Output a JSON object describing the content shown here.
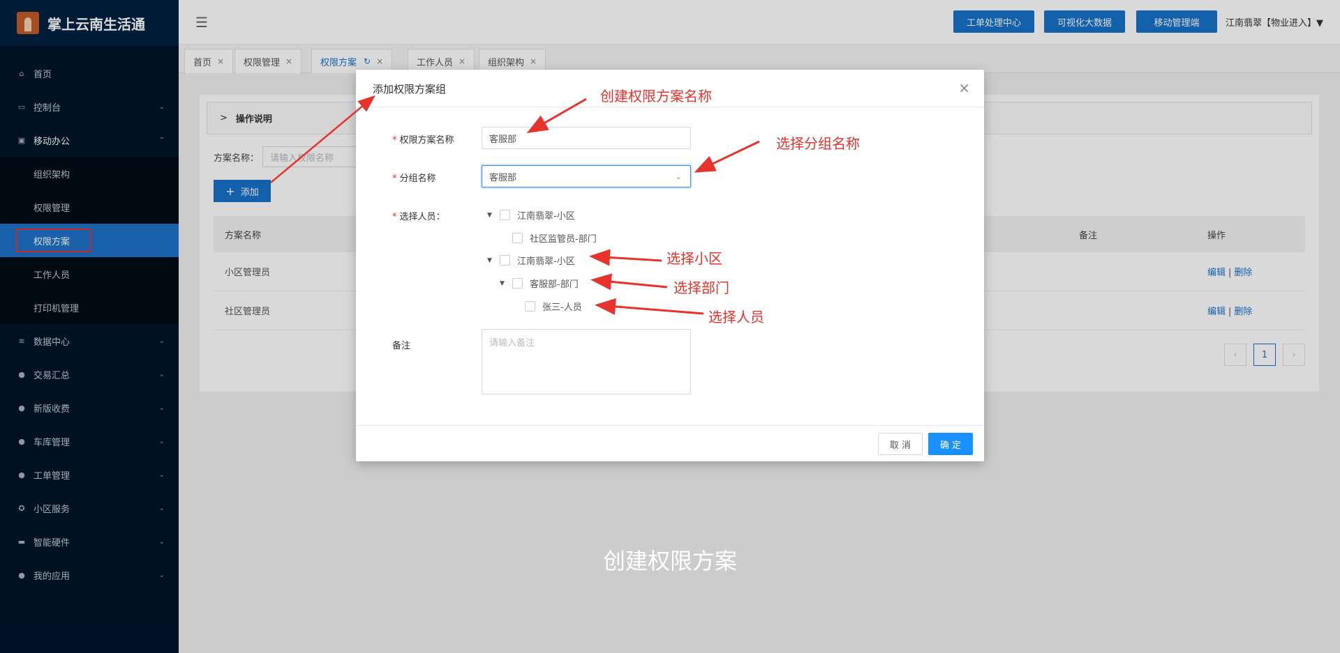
{
  "brand": {
    "title": "掌上云南生活通"
  },
  "sidebar": {
    "items": [
      {
        "label": "首页",
        "icon": "home-icon"
      },
      {
        "label": "控制台",
        "icon": "monitor-icon"
      },
      {
        "label": "移动办公",
        "icon": "briefcase-icon"
      },
      {
        "label": "数据中心",
        "icon": "database-icon"
      },
      {
        "label": "交易汇总",
        "icon": "money-bag-icon"
      },
      {
        "label": "新版收费",
        "icon": "chat-icon"
      },
      {
        "label": "车库管理",
        "icon": "chat-icon"
      },
      {
        "label": "工单管理",
        "icon": "chat-icon"
      },
      {
        "label": "小区服务",
        "icon": "badge-icon"
      },
      {
        "label": "智能硬件",
        "icon": "device-icon"
      },
      {
        "label": "我的应用",
        "icon": "user-icon"
      }
    ],
    "submenu": [
      "组织架构",
      "权限管理",
      "权限方案",
      "工作人员",
      "打印机管理"
    ]
  },
  "header": {
    "buttons": [
      "工单处理中心",
      "可视化大数据",
      "移动管理端"
    ],
    "user": "江南翡翠【物业进入】▼"
  },
  "tabs": [
    "首页",
    "权限管理",
    "权限方案",
    "工作人员",
    "组织架构"
  ],
  "content": {
    "collapse_title": "操作说明",
    "search_label": "方案名称：",
    "search_placeholder": "请输入权限名称",
    "add_label": "添加",
    "columns": [
      "方案名称",
      "备注",
      "操作"
    ],
    "rows": [
      {
        "name": "小区管理员",
        "edit": "编辑",
        "sep": "|",
        "delete": "删除"
      },
      {
        "name": "社区管理员",
        "edit": "编辑",
        "sep": "|",
        "delete": "删除"
      }
    ],
    "page": "1"
  },
  "modal": {
    "title": "添加权限方案组",
    "fields": {
      "name_label": "权限方案名称",
      "name_value": "客服部",
      "group_label": "分组名称",
      "group_value": "客服部",
      "people_label": "选择人员：",
      "note_label": "备注",
      "note_placeholder": "请输入备注"
    },
    "tree": [
      "江南翡翠-小区",
      "社区监管员-部门",
      "江南翡翠-小区",
      "客服部-部门",
      "张三-人员"
    ],
    "cancel": "取 消",
    "ok": "确 定"
  },
  "annotations": {
    "a1": "创建权限方案名称",
    "a2": "选择分组名称",
    "a3": "选择小区",
    "a4": "选择部门",
    "a5": "选择人员"
  },
  "caption": "创建权限方案"
}
